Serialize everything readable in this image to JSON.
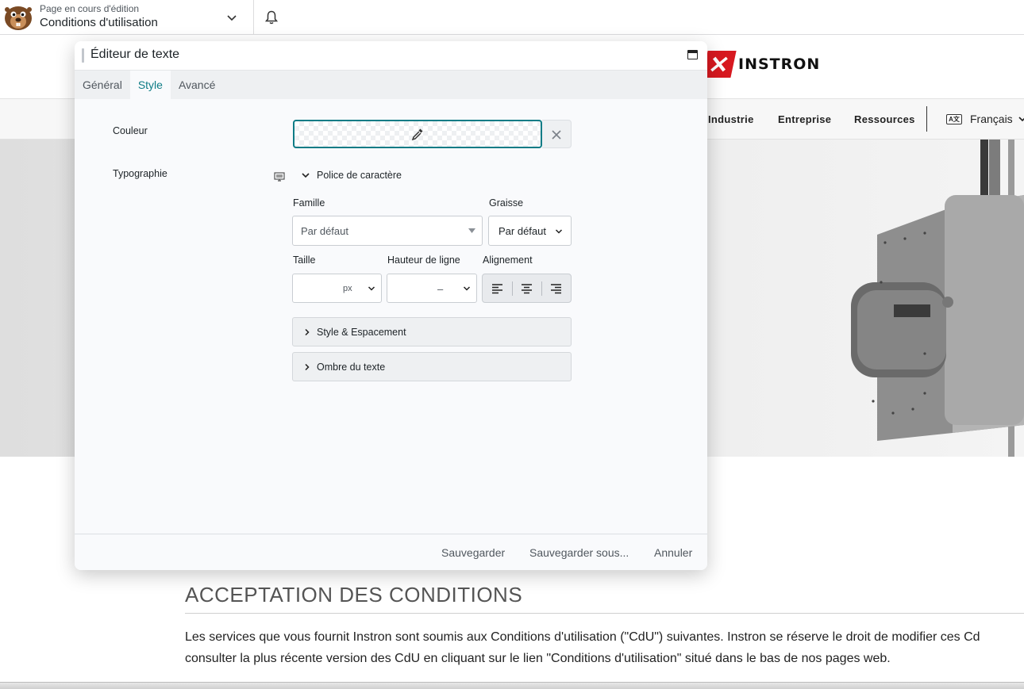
{
  "topbar": {
    "page_status": "Page en cours d'édition",
    "page_title": "Conditions d'utilisation"
  },
  "site": {
    "logo_text": "INSTRON",
    "nav": [
      "Industrie",
      "Entreprise",
      "Ressources"
    ],
    "language": "Français",
    "language_icon_text": "A文",
    "heading": "ACCEPTATION DES CONDITIONS",
    "paragraph_line1": "Les services que vous fournit Instron sont soumis aux Conditions d'utilisation (\"CdU\") suivantes. Instron se réserve le droit de modifier ces Cd",
    "paragraph_line2": "consulter la plus récente version des CdU en cliquant sur le lien \"Conditions d'utilisation\" situé dans le bas de nos pages web.",
    "brand_color": "#d71920"
  },
  "modal": {
    "title": "Éditeur de texte",
    "tabs": [
      {
        "label": "Général",
        "active": false
      },
      {
        "label": "Style",
        "active": true
      },
      {
        "label": "Avancé",
        "active": false
      }
    ],
    "accent_color": "#0e7c86",
    "color_label": "Couleur",
    "typography_label": "Typographie",
    "font_section": "Police de caractère",
    "family_label": "Famille",
    "family_value": "Par défaut",
    "weight_label": "Graisse",
    "weight_value": "Par défaut",
    "size_label": "Taille",
    "size_unit": "px",
    "line_height_label": "Hauteur de ligne",
    "line_height_value": "–",
    "alignment_label": "Alignement",
    "style_spacing": "Style & Espacement",
    "text_shadow": "Ombre du texte",
    "save": "Sauvegarder",
    "save_as": "Sauvegarder sous...",
    "cancel": "Annuler"
  }
}
